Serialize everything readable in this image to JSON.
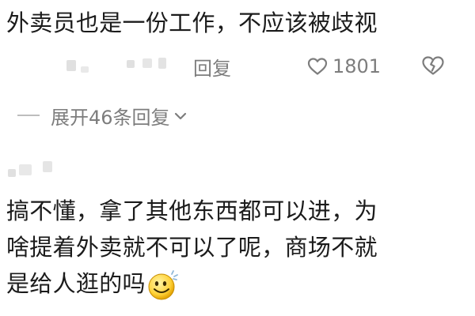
{
  "comment_1": {
    "text": "外卖员也是一份工作，不应该被歧视"
  },
  "meta": {
    "reply_label": "回复",
    "like_count": "1801",
    "icons": {
      "like": "heart-outline-icon",
      "dislike": "broken-heart-outline-icon"
    }
  },
  "replies": {
    "expand_label": "展开46条回复",
    "icon": "chevron-down-icon"
  },
  "comment_2": {
    "line_1": "搞不懂，拿了其他东西都可以进，为",
    "line_2": "啥提着外卖就不可以了呢，商场不就",
    "line_3": "是给人逛的吗",
    "emoji": "grinning-face-emoji"
  },
  "colors": {
    "text": "#1b1b1b",
    "secondary": "#7d7d7d",
    "masked": "#e0e0e0"
  }
}
